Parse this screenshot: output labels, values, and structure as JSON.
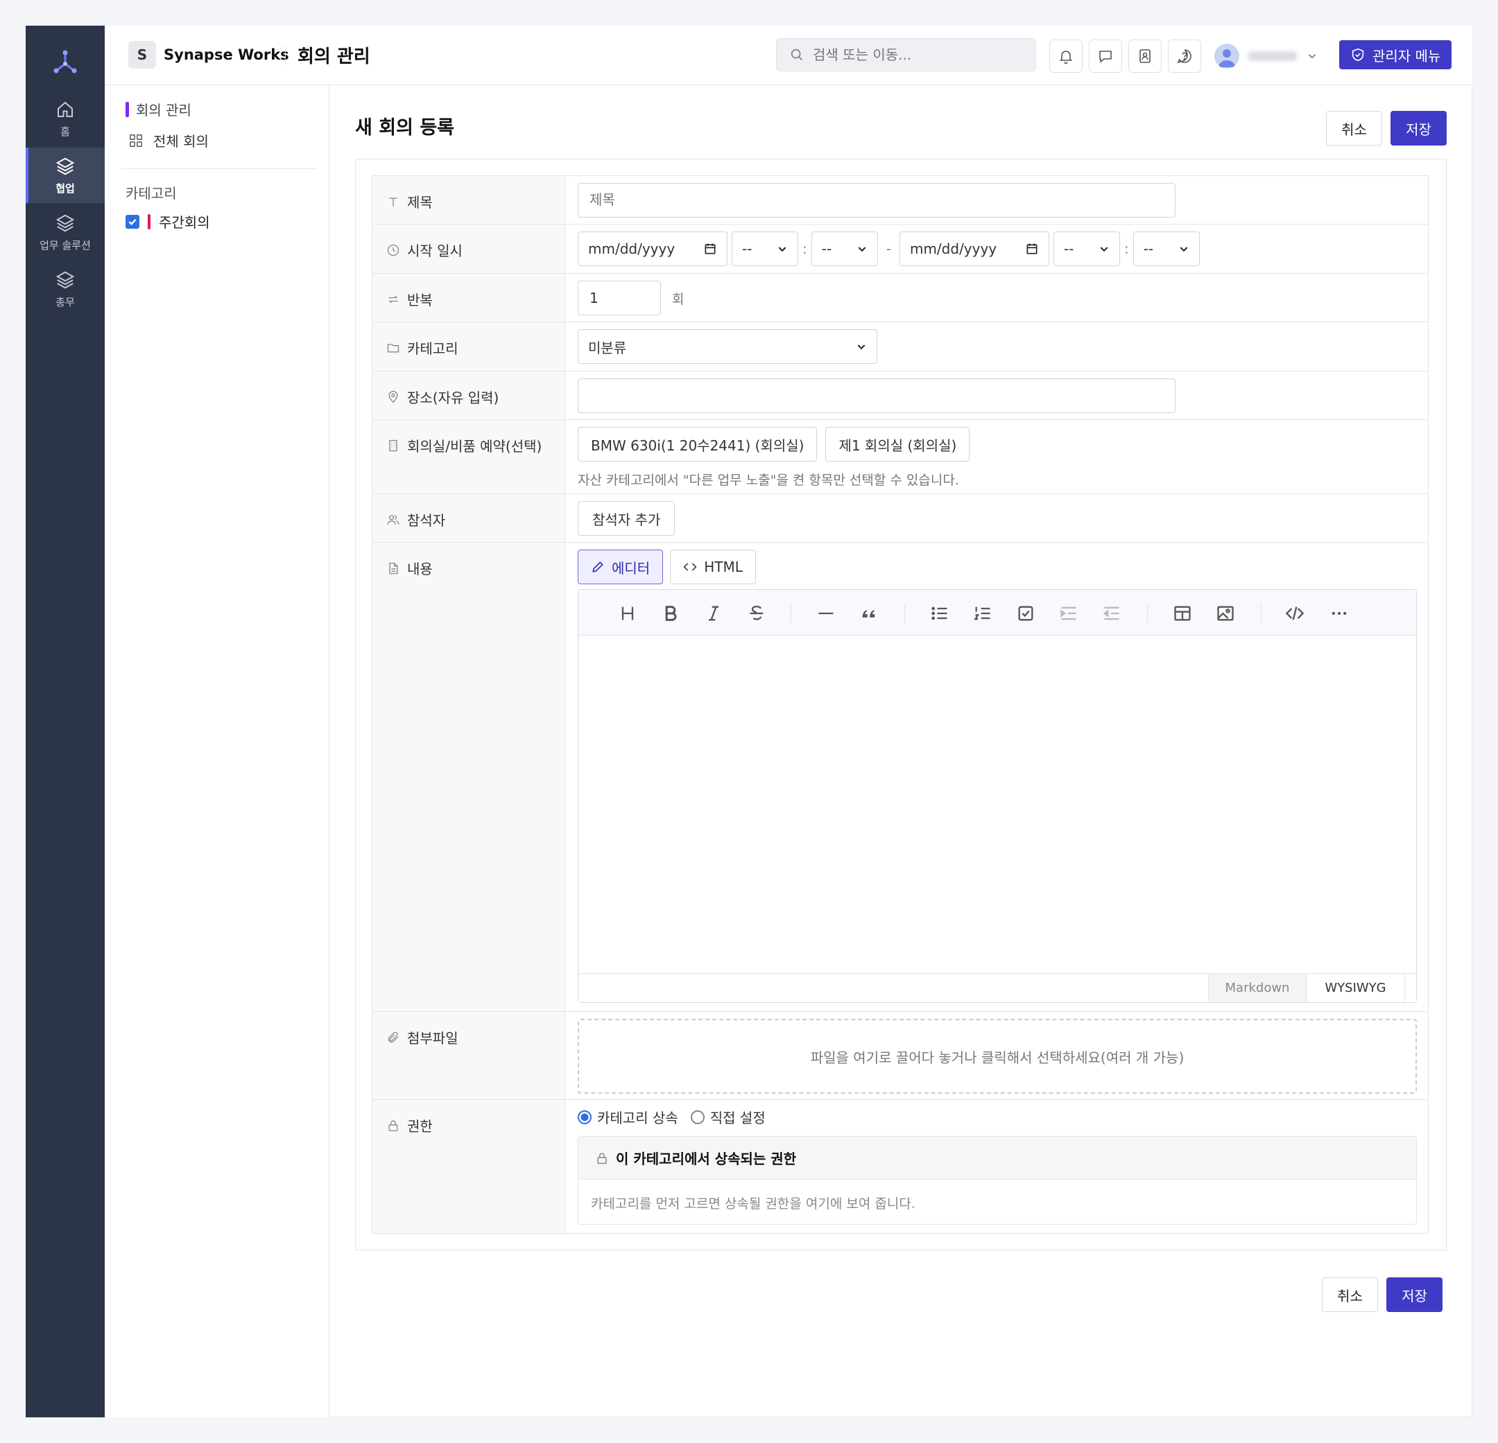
{
  "header": {
    "brand_initial": "S",
    "brand_name": "Synapse Works",
    "module_title": "회의 관리",
    "search_placeholder": "검색 또는 이동...",
    "admin_button": "관리자 메뉴"
  },
  "rail": {
    "items": [
      {
        "label": "홈",
        "icon": "home-icon"
      },
      {
        "label": "협업",
        "icon": "layers-icon",
        "active": true
      },
      {
        "label": "업무 솔루션",
        "icon": "layers-icon"
      },
      {
        "label": "총무",
        "icon": "layers-icon"
      }
    ]
  },
  "subside": {
    "section_title": "회의 관리",
    "all_meetings": "전체 회의",
    "category_label": "카테고리",
    "categories": [
      {
        "label": "주간회의",
        "checked": true,
        "color": "#e0155f"
      }
    ]
  },
  "main": {
    "page_title": "새 회의 등록",
    "cancel_label": "취소",
    "save_label": "저장"
  },
  "form": {
    "title": {
      "label": "제목",
      "placeholder": "제목"
    },
    "start": {
      "label": "시작 일시",
      "date1": "mm/dd/yyyy",
      "hour1": "--",
      "min1": "--",
      "dash": "-",
      "date2": "mm/dd/yyyy",
      "hour2": "--",
      "min2": "--",
      "colon": ":"
    },
    "repeat": {
      "label": "반복",
      "value": "1",
      "unit": "회"
    },
    "category": {
      "label": "카테고리",
      "selected": "미분류"
    },
    "place": {
      "label": "장소(자유 입력)",
      "value": ""
    },
    "room": {
      "label": "회의실/비품 예약(선택)",
      "options": [
        "BMW 630i(1 20수2441) (회의실)",
        "제1 회의실 (회의실)"
      ],
      "hint": "자산 카테고리에서 \"다른 업무 노출\"을 켠 항목만 선택할 수 있습니다."
    },
    "attendees": {
      "label": "참석자",
      "add_button": "참석자 추가"
    },
    "content": {
      "label": "내용",
      "tab_editor": "에디터",
      "tab_html": "HTML",
      "mode_markdown": "Markdown",
      "mode_wysiwyg": "WYSIWYG"
    },
    "attachment": {
      "label": "첨부파일",
      "drop_text": "파일을 여기로 끌어다 놓거나 클릭해서 선택하세요(여러 개 가능)"
    },
    "permission": {
      "label": "권한",
      "option_inherit": "카테고리 상속",
      "option_direct": "직접 설정",
      "selected": "카테고리 상속",
      "box_title": "이 카테고리에서 상속되는 권한",
      "box_text": "카테고리를 먼저 고르면 상속될 권한을 여기에 보여 줍니다."
    }
  },
  "colors": {
    "primary": "#3f3bc6",
    "rail": "#2c3447",
    "accent_purple": "#7b2cf2",
    "category_pink": "#e0155f"
  }
}
